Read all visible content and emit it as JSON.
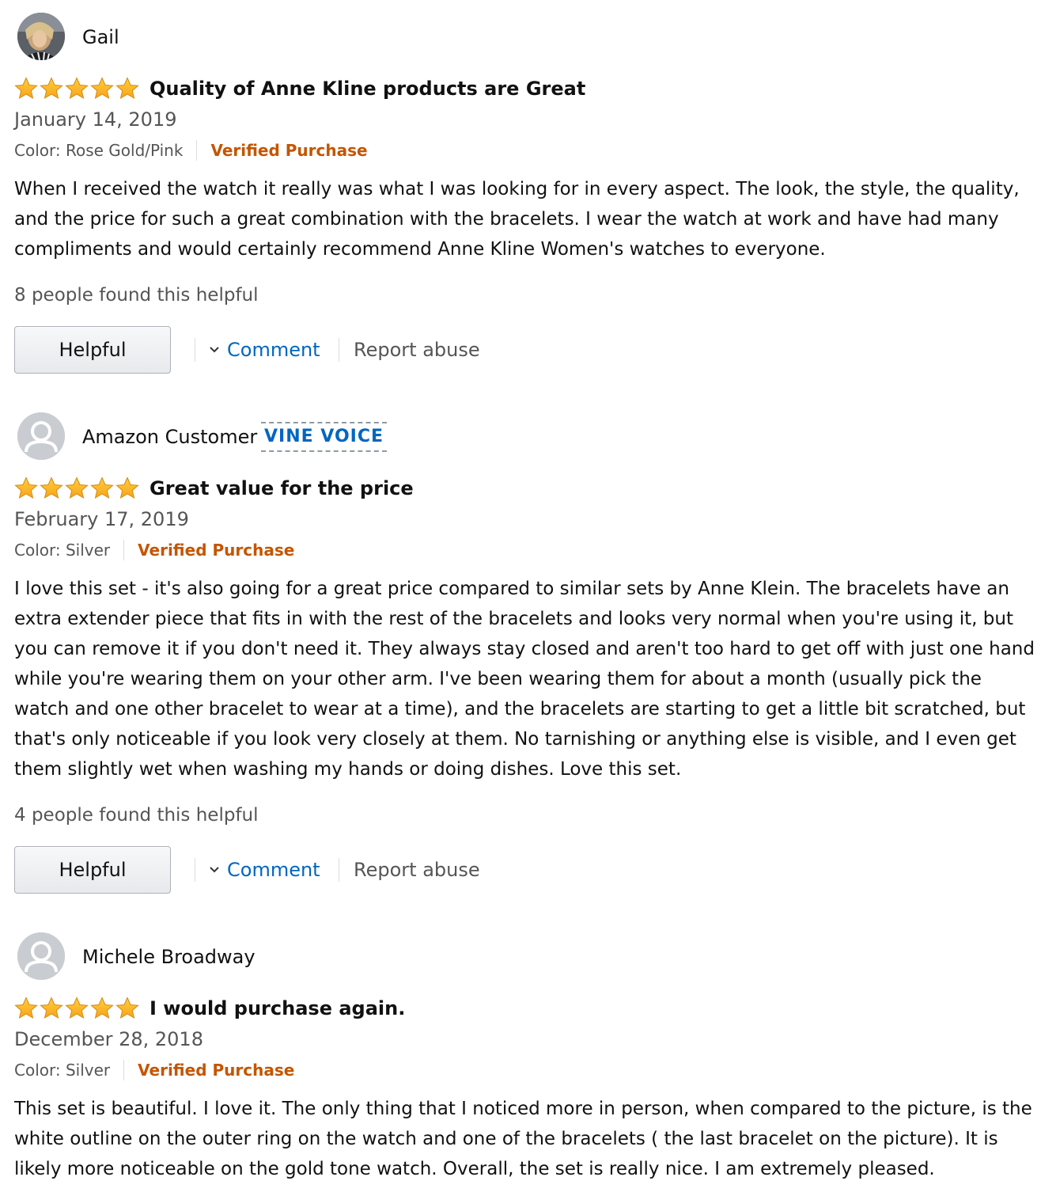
{
  "reviews": [
    {
      "user": "Gail",
      "avatar": "user-photo",
      "badge": "",
      "rating": 5,
      "title": "Quality of Anne Kline products are Great",
      "date": "January 14, 2019",
      "color": "Color: Rose Gold/Pink",
      "verified": "Verified Purchase",
      "body": "When I received the watch it really was what I was looking for in every aspect. The look, the style, the quality, and the price for such a great combination with the bracelets. I wear the watch at work and have had many compliments and would certainly recommend Anne Kline Women's watches to everyone.",
      "helpful_count": "8 people found this helpful",
      "helpful_button": "Helpful",
      "comment": "Comment",
      "report": "Report abuse"
    },
    {
      "user": "Amazon Customer",
      "avatar": "default-avatar",
      "badge": "VINE VOICE",
      "rating": 5,
      "title": "Great value for the price",
      "date": "February 17, 2019",
      "color": "Color: Silver",
      "verified": "Verified Purchase",
      "body": "I love this set - it's also going for a great price compared to similar sets by Anne Klein. The bracelets have an extra extender piece that fits in with the rest of the bracelets and looks very normal when you're using it, but you can remove it if you don't need it. They always stay closed and aren't too hard to get off with just one hand while you're wearing them on your other arm. I've been wearing them for about a month (usually pick the watch and one other bracelet to wear at a time), and the bracelets are starting to get a little bit scratched, but that's only noticeable if you look very closely at them. No tarnishing or anything else is visible, and I even get them slightly wet when washing my hands or doing dishes. Love this set.",
      "helpful_count": "4 people found this helpful",
      "helpful_button": "Helpful",
      "comment": "Comment",
      "report": "Report abuse"
    },
    {
      "user": "Michele Broadway",
      "avatar": "default-avatar",
      "badge": "",
      "rating": 5,
      "title": "I would purchase again.",
      "date": "December 28, 2018",
      "color": "Color: Silver",
      "verified": "Verified Purchase",
      "body": "This set is beautiful. I love it. The only thing that I noticed more in person, when compared to the picture, is the white outline on the outer ring on the watch and one of the bracelets ( the last bracelet on the picture). It is likely more noticeable on the gold tone watch. Overall, the set is really nice. I am extremely pleased."
    }
  ],
  "colors": {
    "link": "#0066c0",
    "verified": "#c45500",
    "star": "#ffa41c",
    "muted": "#555555"
  }
}
